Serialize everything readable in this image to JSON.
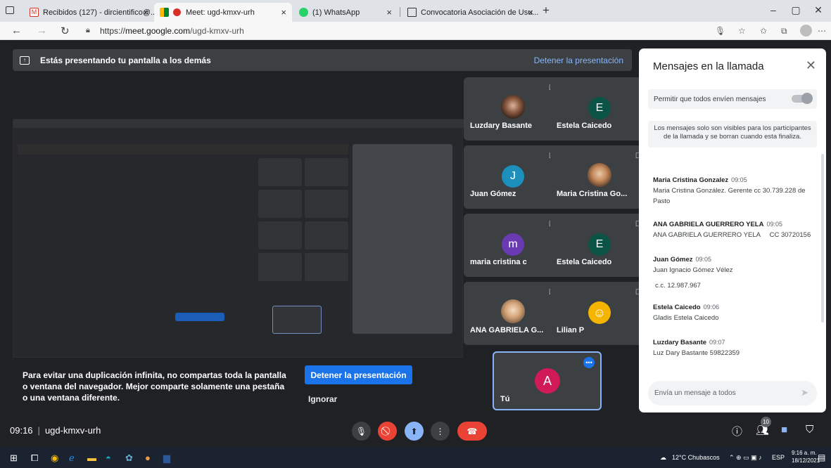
{
  "browser": {
    "tabs": [
      {
        "label": "Recibidos (127) - dircientifico@..."
      },
      {
        "label": "Meet: ugd-kmxv-urh"
      },
      {
        "label": "(1) WhatsApp"
      },
      {
        "label": "Convocatoria Asociación de Usu..."
      }
    ],
    "url_prefix": "https://",
    "url_host": "meet.google.com",
    "url_path": "/ugd-kmxv-urh"
  },
  "presentation_bar": {
    "message": "Estás presentando tu pantalla a los demás",
    "stop_link": "Detener la presentación"
  },
  "participants": [
    {
      "name": "Luzdary Basante",
      "initial": "",
      "avatar_color": "#ffffff"
    },
    {
      "name": "Estela Caicedo",
      "initial": "E",
      "avatar_color": "#0b5345"
    },
    {
      "name": "Juan Gómez",
      "initial": "J",
      "avatar_color": "#1c8fbd"
    },
    {
      "name": "Maria Cristina Go...",
      "initial": "",
      "avatar_color": "#ffffff"
    },
    {
      "name": "maria cristina c",
      "initial": "m",
      "avatar_color": "#6a3ab2"
    },
    {
      "name": "Estela Caicedo",
      "initial": "E",
      "avatar_color": "#0b5345"
    },
    {
      "name": "ANA GABRIELA G...",
      "initial": "",
      "avatar_color": "#ffffff"
    },
    {
      "name": "Lilian P",
      "initial": "",
      "avatar_color": "#f4b400"
    }
  ],
  "self_tile": {
    "name": "Tú",
    "initial": "A"
  },
  "warning": {
    "text": "Para evitar una duplicación infinita, no compartas toda la pantalla o ventana del navegador. Mejor comparte solamente una pestaña o una ventana diferente.",
    "stop_button": "Detener la presentación",
    "ignore_button": "Ignorar"
  },
  "chat": {
    "title": "Mensajes en la llamada",
    "allow_label": "Permitir que todos envíen mensajes",
    "notice": "Los mensajes solo son visibles para los participantes de la llamada y se borran cuando esta finaliza.",
    "messages": [
      {
        "sender": "Maria Cristina Gonzalez",
        "time": "09:05",
        "text": "Maria Cristina González. Gerente cc 30.739.228 de Pasto"
      },
      {
        "sender": "ANA GABRIELA GUERRERO YELA",
        "time": "09:05",
        "text": "ANA GABRIELA GUERRERO YELA     CC 30720156"
      },
      {
        "sender": "Juan Gómez",
        "time": "09:05",
        "text": "Juan Ignacio Gómez Vélez"
      },
      {
        "sender": "",
        "time": "",
        "text": "c.c. 12.987.967"
      },
      {
        "sender": "Estela Caicedo",
        "time": "09:06",
        "text": "Gladis Estela Caicedo"
      },
      {
        "sender": "Luzdary Basante",
        "time": "09:07",
        "text": "Luz Dary Bastante 59822359"
      }
    ],
    "input_placeholder": "Envía un mensaje a todos"
  },
  "bottom_bar": {
    "time": "09:16",
    "meeting_code": "ugd-kmxv-urh",
    "participant_count": "10"
  },
  "taskbar": {
    "weather": "12°C  Chubascos",
    "lang": "ESP",
    "clock_time": "9:16 a. m.",
    "clock_date": "18/12/2021"
  },
  "colors": {
    "accent": "#1a73e8",
    "end_call": "#ea4335",
    "meet_bg": "#202124"
  }
}
